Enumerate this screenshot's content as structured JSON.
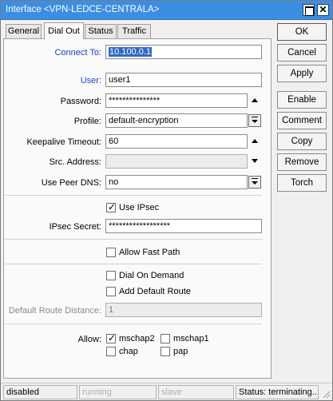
{
  "window": {
    "title": "Interface <VPN-LEDCE-CENTRALA>"
  },
  "tabs": [
    {
      "label": "General",
      "active": false
    },
    {
      "label": "Dial Out",
      "active": true
    },
    {
      "label": "Status",
      "active": false
    },
    {
      "label": "Traffic",
      "active": false
    }
  ],
  "form": {
    "connect_to": {
      "label": "Connect To:",
      "value": "10.100.0.1"
    },
    "user": {
      "label": "User:",
      "value": "user1"
    },
    "password": {
      "label": "Password:",
      "value": "***************"
    },
    "profile": {
      "label": "Profile:",
      "value": "default-encryption"
    },
    "keepalive": {
      "label": "Keepalive Timeout:",
      "value": "60"
    },
    "src_address": {
      "label": "Src. Address:",
      "value": ""
    },
    "use_peer_dns": {
      "label": "Use Peer DNS:",
      "value": "no"
    },
    "use_ipsec": {
      "label": "Use IPsec",
      "checked": true
    },
    "ipsec_secret": {
      "label": "IPsec Secret:",
      "value": "******************"
    },
    "allow_fast_path": {
      "label": "Allow Fast Path",
      "checked": false
    },
    "dial_on_demand": {
      "label": "Dial On Demand",
      "checked": false
    },
    "add_default_route": {
      "label": "Add Default Route",
      "checked": false
    },
    "default_route_distance": {
      "label": "Default Route Distance:",
      "value": "1"
    },
    "allow": {
      "label": "Allow:",
      "options": [
        {
          "label": "mschap2",
          "checked": true
        },
        {
          "label": "mschap1",
          "checked": false
        },
        {
          "label": "chap",
          "checked": false
        },
        {
          "label": "pap",
          "checked": false
        }
      ]
    }
  },
  "buttons": {
    "ok": "OK",
    "cancel": "Cancel",
    "apply": "Apply",
    "enable": "Enable",
    "comment": "Comment",
    "copy": "Copy",
    "remove": "Remove",
    "torch": "Torch"
  },
  "status_bar": {
    "state": "disabled",
    "running": "running",
    "slave": "slave",
    "status": "Status: terminating..."
  }
}
